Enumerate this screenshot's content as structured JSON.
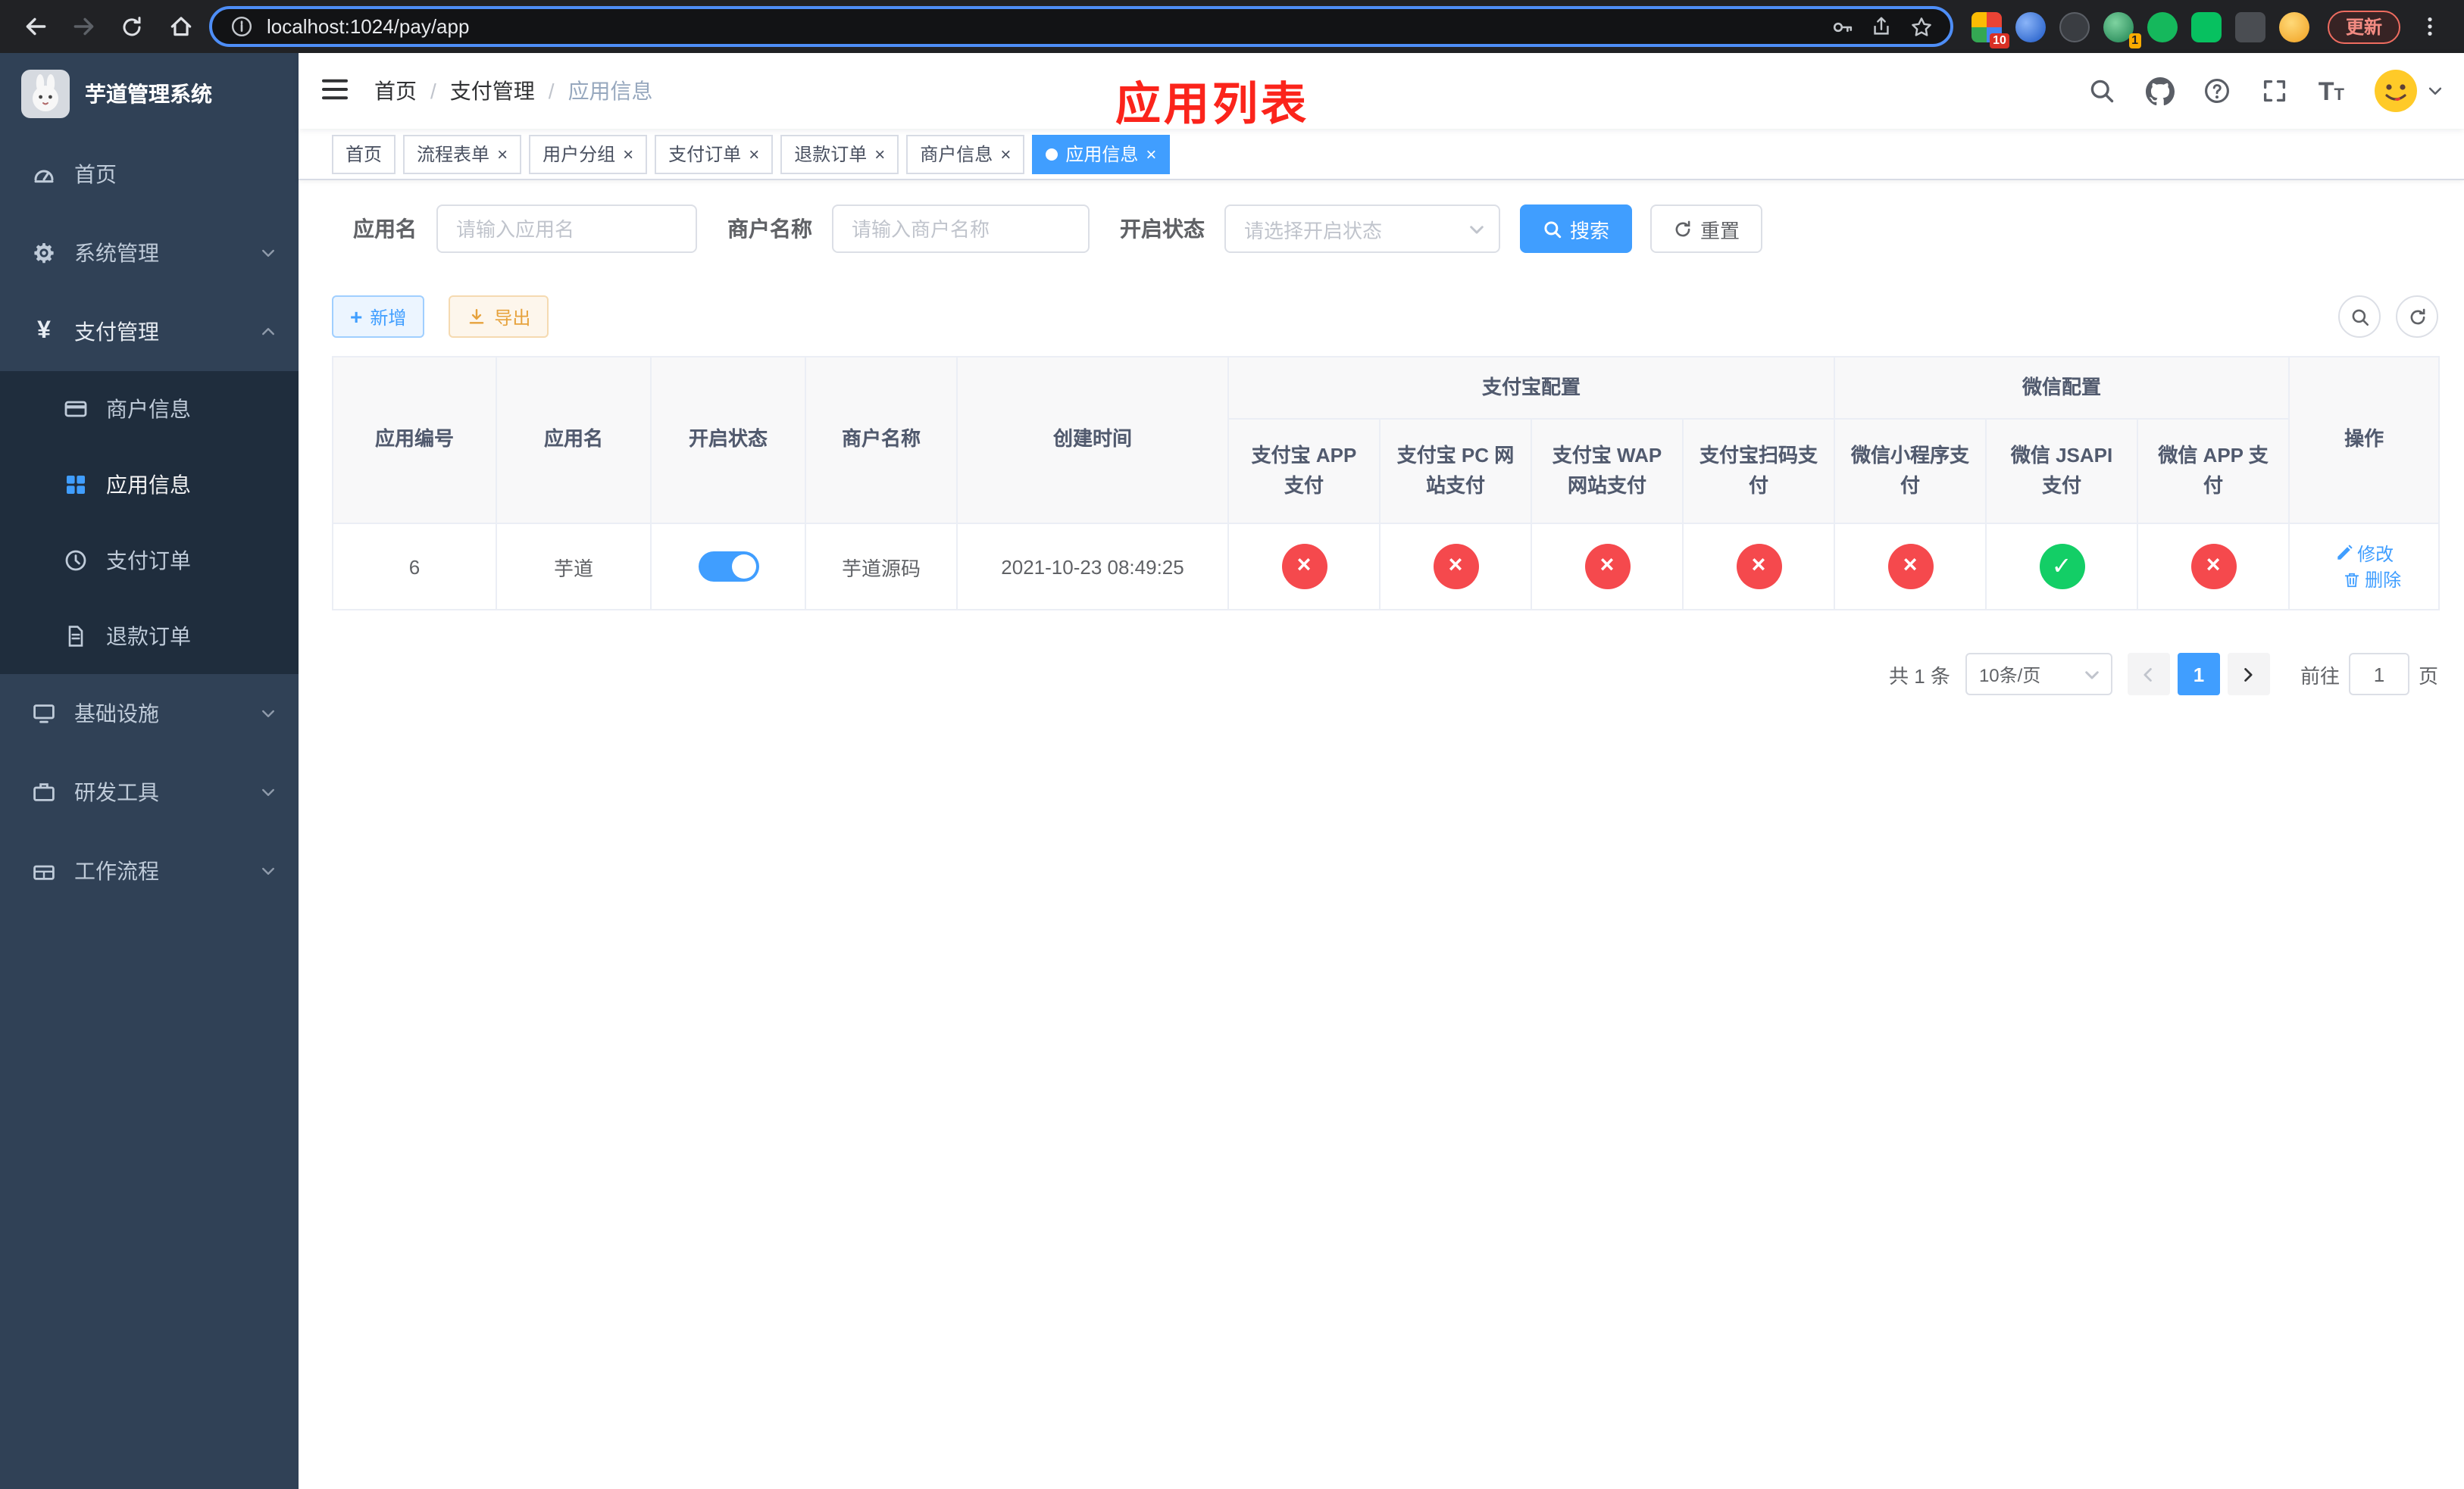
{
  "icons": {
    "yen": "¥",
    "close": "×",
    "plus": "+",
    "check": "✓",
    "cross": "×",
    "breadcrumb_separator": "/"
  },
  "browser": {
    "url": "localhost:1024/pay/app",
    "update_label": "更新",
    "badge_1": "10",
    "badge_2": "1"
  },
  "sidebar": {
    "logo_title": "芋道管理系统",
    "items": [
      {
        "label": "首页"
      },
      {
        "label": "系统管理"
      },
      {
        "label": "支付管理"
      },
      {
        "label": "基础设施"
      },
      {
        "label": "研发工具"
      },
      {
        "label": "工作流程"
      }
    ],
    "payment_children": [
      {
        "label": "商户信息"
      },
      {
        "label": "应用信息"
      },
      {
        "label": "支付订单"
      },
      {
        "label": "退款订单"
      }
    ]
  },
  "header": {
    "breadcrumb": {
      "home": "首页",
      "section": "支付管理",
      "current": "应用信息"
    },
    "overlay_title": "应用列表"
  },
  "tabs": [
    {
      "label": "首页",
      "closable": false,
      "active": false
    },
    {
      "label": "流程表单",
      "closable": true,
      "active": false
    },
    {
      "label": "用户分组",
      "closable": true,
      "active": false
    },
    {
      "label": "支付订单",
      "closable": true,
      "active": false
    },
    {
      "label": "退款订单",
      "closable": true,
      "active": false
    },
    {
      "label": "商户信息",
      "closable": true,
      "active": false
    },
    {
      "label": "应用信息",
      "closable": true,
      "active": true
    }
  ],
  "filters": {
    "app_name_label": "应用名",
    "app_name_placeholder": "请输入应用名",
    "merchant_label": "商户名称",
    "merchant_placeholder": "请输入商户名称",
    "status_label": "开启状态",
    "status_placeholder": "请选择开启状态",
    "search_button": "搜索",
    "reset_button": "重置"
  },
  "toolbar": {
    "add_button": "新增",
    "export_button": "导出"
  },
  "table": {
    "groups": {
      "alipay": "支付宝配置",
      "wechat": "微信配置"
    },
    "columns": {
      "app_id": "应用编号",
      "app_name": "应用名",
      "status": "开启状态",
      "merchant": "商户名称",
      "created": "创建时间",
      "alipay_app": "支付宝 APP 支付",
      "alipay_pc": "支付宝 PC 网站支付",
      "alipay_wap": "支付宝 WAP 网站支付",
      "alipay_qr": "支付宝扫码支付",
      "wx_lite": "微信小程序支付",
      "wx_jsapi": "微信 JSAPI 支付",
      "wx_app": "微信 APP 支付",
      "actions": "操作"
    },
    "rows": [
      {
        "app_id": "6",
        "app_name": "芋道",
        "status_on": true,
        "merchant": "芋道源码",
        "created": "2021-10-23 08:49:25",
        "configs": [
          "no",
          "no",
          "no",
          "no",
          "no",
          "yes",
          "no"
        ],
        "edit_label": "修改",
        "delete_label": "删除"
      }
    ]
  },
  "pagination": {
    "total_text": "共 1 条",
    "page_size": "10条/页",
    "current_page": "1",
    "goto_label": "前往",
    "goto_value": "1",
    "goto_unit": "页"
  }
}
